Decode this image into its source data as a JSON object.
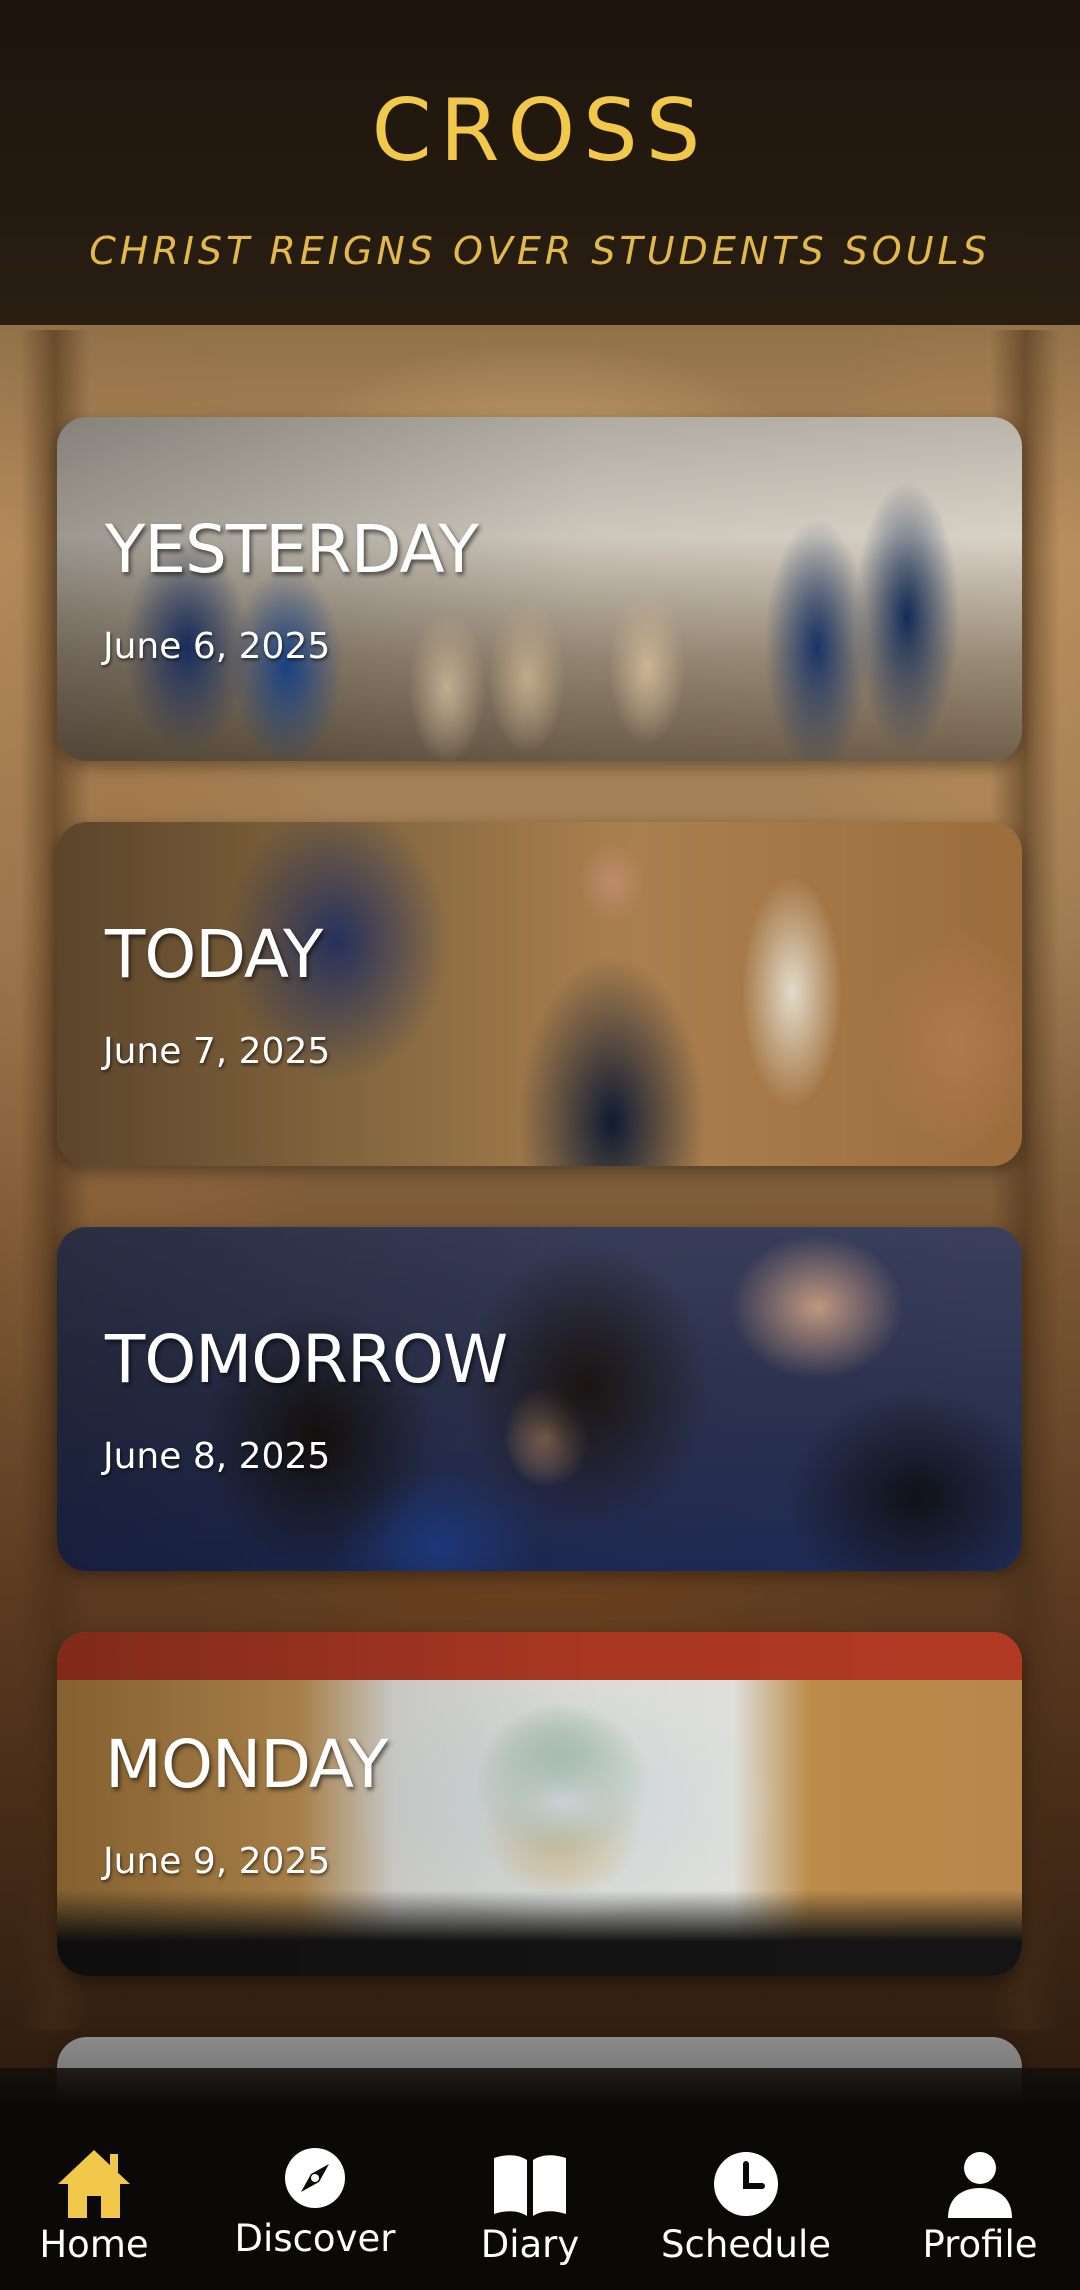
{
  "header": {
    "title": "CROSS",
    "subtitle": "CHRIST REIGNS OVER STUDENTS SOULS"
  },
  "cards": [
    {
      "day": "YESTERDAY",
      "date": "June 6, 2025"
    },
    {
      "day": "TODAY",
      "date": "June 7, 2025"
    },
    {
      "day": "TOMORROW",
      "date": "June 8, 2025"
    },
    {
      "day": "MONDAY",
      "date": "June 9, 2025"
    }
  ],
  "bottom_nav": {
    "items": [
      {
        "label": "Home",
        "icon": "home-icon",
        "active": true
      },
      {
        "label": "Discover",
        "icon": "compass-icon",
        "active": false
      },
      {
        "label": "Diary",
        "icon": "book-icon",
        "active": false
      },
      {
        "label": "Schedule",
        "icon": "clock-icon",
        "active": false
      },
      {
        "label": "Profile",
        "icon": "user-icon",
        "active": false
      }
    ]
  },
  "colors": {
    "accent": "#f2c84b",
    "nav_active": "#f2c84b",
    "nav_inactive": "#ffffff",
    "header_bg": "#1c140c"
  }
}
